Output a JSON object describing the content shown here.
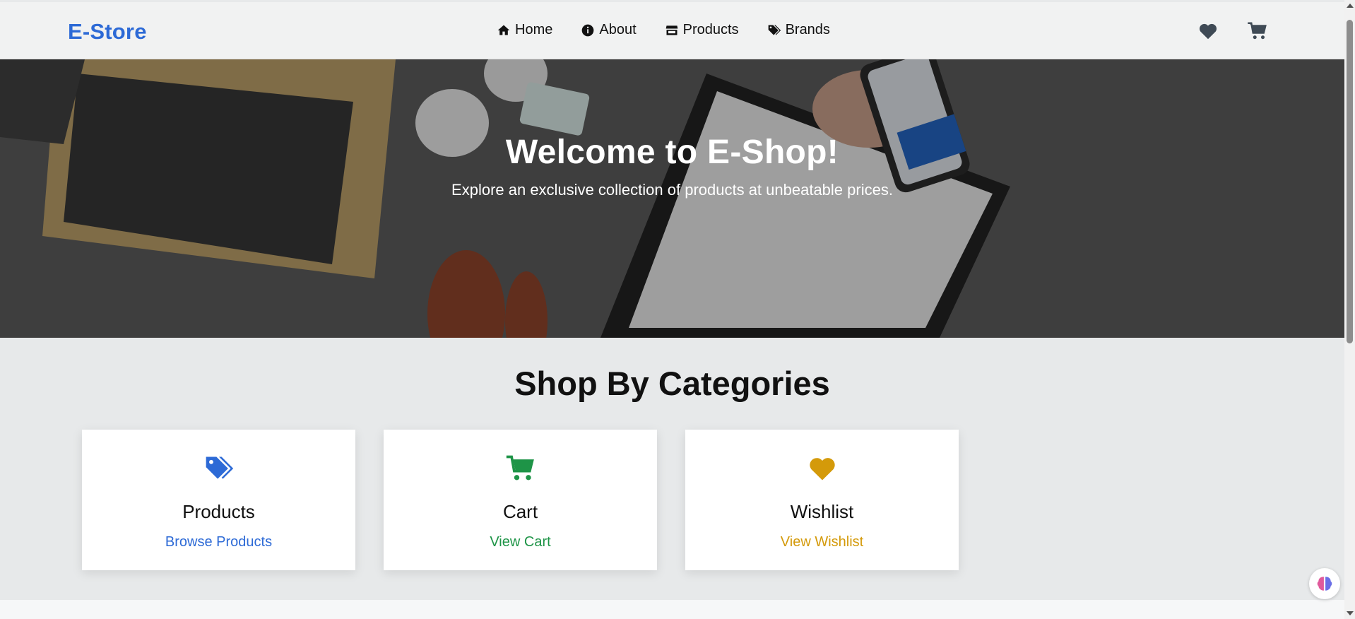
{
  "navbar": {
    "brand": "E-Store",
    "links": [
      {
        "label": "Home",
        "icon": "home-icon"
      },
      {
        "label": "About",
        "icon": "info-icon"
      },
      {
        "label": "Products",
        "icon": "store-icon"
      },
      {
        "label": "Brands",
        "icon": "tags-icon"
      }
    ],
    "right_icons": [
      "heart-icon",
      "cart-icon"
    ]
  },
  "hero": {
    "title": "Welcome to E-Shop!",
    "subtitle": "Explore an exclusive collection of products at unbeatable prices."
  },
  "categories": {
    "heading": "Shop By Categories",
    "cards": [
      {
        "title": "Products",
        "link": "Browse Products",
        "icon": "tags-icon",
        "color": "#2d6ad6"
      },
      {
        "title": "Cart",
        "link": "View Cart",
        "icon": "cart-icon",
        "color": "#1e9447"
      },
      {
        "title": "Wishlist",
        "link": "View Wishlist",
        "icon": "heart-icon",
        "color": "#d49a0a"
      }
    ]
  },
  "colors": {
    "brand": "#2d6ad6",
    "navbar_bg": "#f1f2f2",
    "page_bg": "#e7e9ea"
  }
}
